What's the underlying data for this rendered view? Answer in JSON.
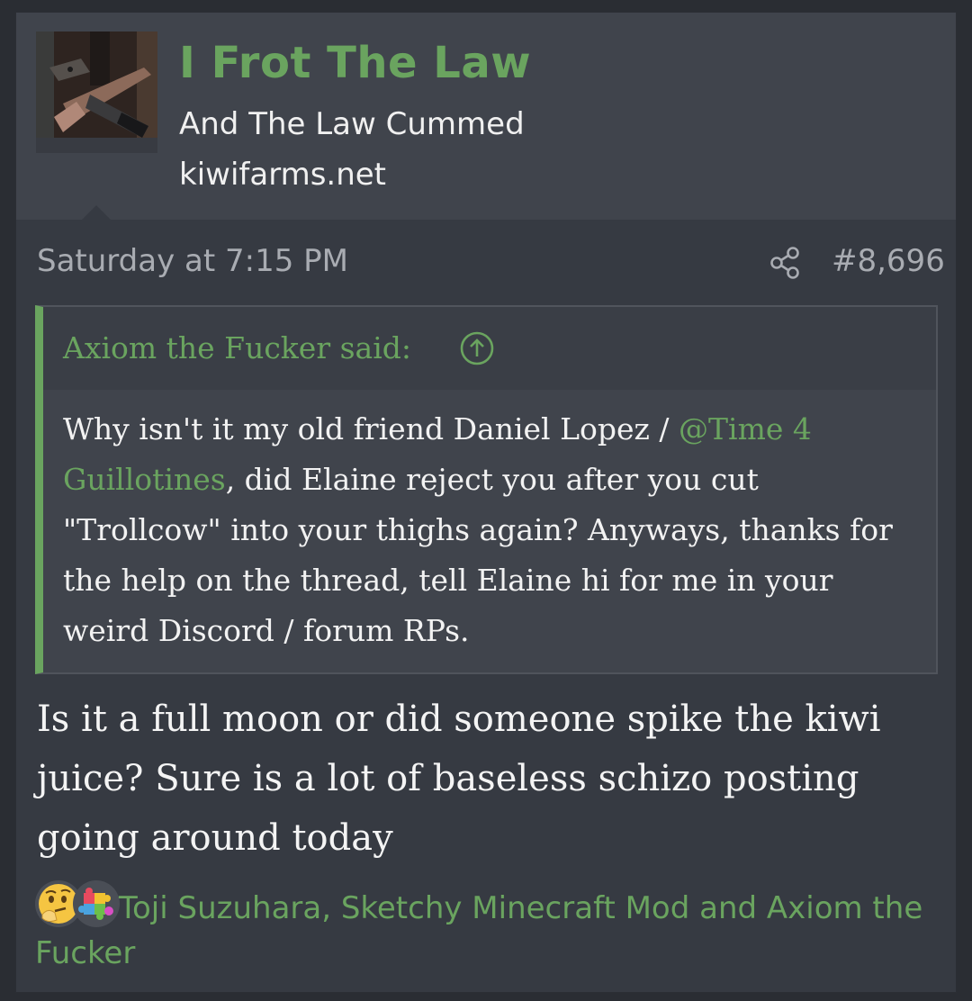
{
  "user": {
    "name": "I Frot The Law",
    "title": "And The Law Cummed",
    "site": "kiwifarms.net"
  },
  "post": {
    "date": "Saturday at 7:15 PM",
    "number": "#8,696"
  },
  "quote": {
    "author": "Axiom the Fucker said:",
    "text_before": "Why isn't it my old friend Daniel Lopez / ",
    "mention": "@Time 4 Guillotines",
    "text_after": ", did Elaine reject you after you cut \"Trollcow\" into your thighs again? Anyways, thanks for the help on the thread, tell Elaine hi for me in your weird Discord / forum RPs."
  },
  "message": "Is it a full moon or did someone spike the kiwi juice? Sure is a lot of baseless schizo posting going around today",
  "reactions": {
    "icons": [
      "thinking-face-icon",
      "puzzle-piece-icon"
    ],
    "users_text": "Toji Suzuhara, Sketchy Minecraft Mod and Axiom the Fucker"
  },
  "colors": {
    "accent_green": "#6aa45f",
    "post_background": "#363a42",
    "header_background": "#40444c"
  }
}
